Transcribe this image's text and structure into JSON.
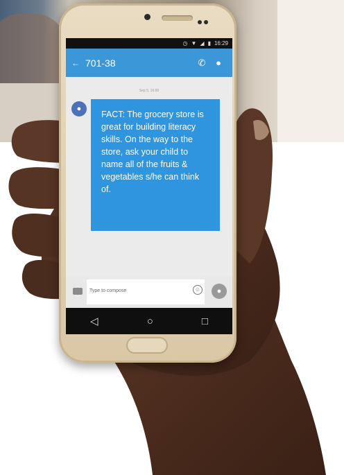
{
  "status": {
    "icons": [
      "alarm-icon",
      "wifi-icon",
      "signal-icon",
      "battery-icon"
    ],
    "time": "16:29"
  },
  "header": {
    "title": "701-38",
    "call_icon": "phone-icon",
    "contact_icon": "person-icon"
  },
  "thread": {
    "date": "Sep 5, 16:00",
    "message": "FACT: The grocery store is great for building literacy skills. On the way to the store, ask your child to name all of the fruits & vegetables s/he can think of."
  },
  "compose": {
    "placeholder": "Type to compose"
  },
  "colors": {
    "appbar": "#3b97d8",
    "bubble": "#2f95de",
    "avatar": "#4c71b8"
  }
}
